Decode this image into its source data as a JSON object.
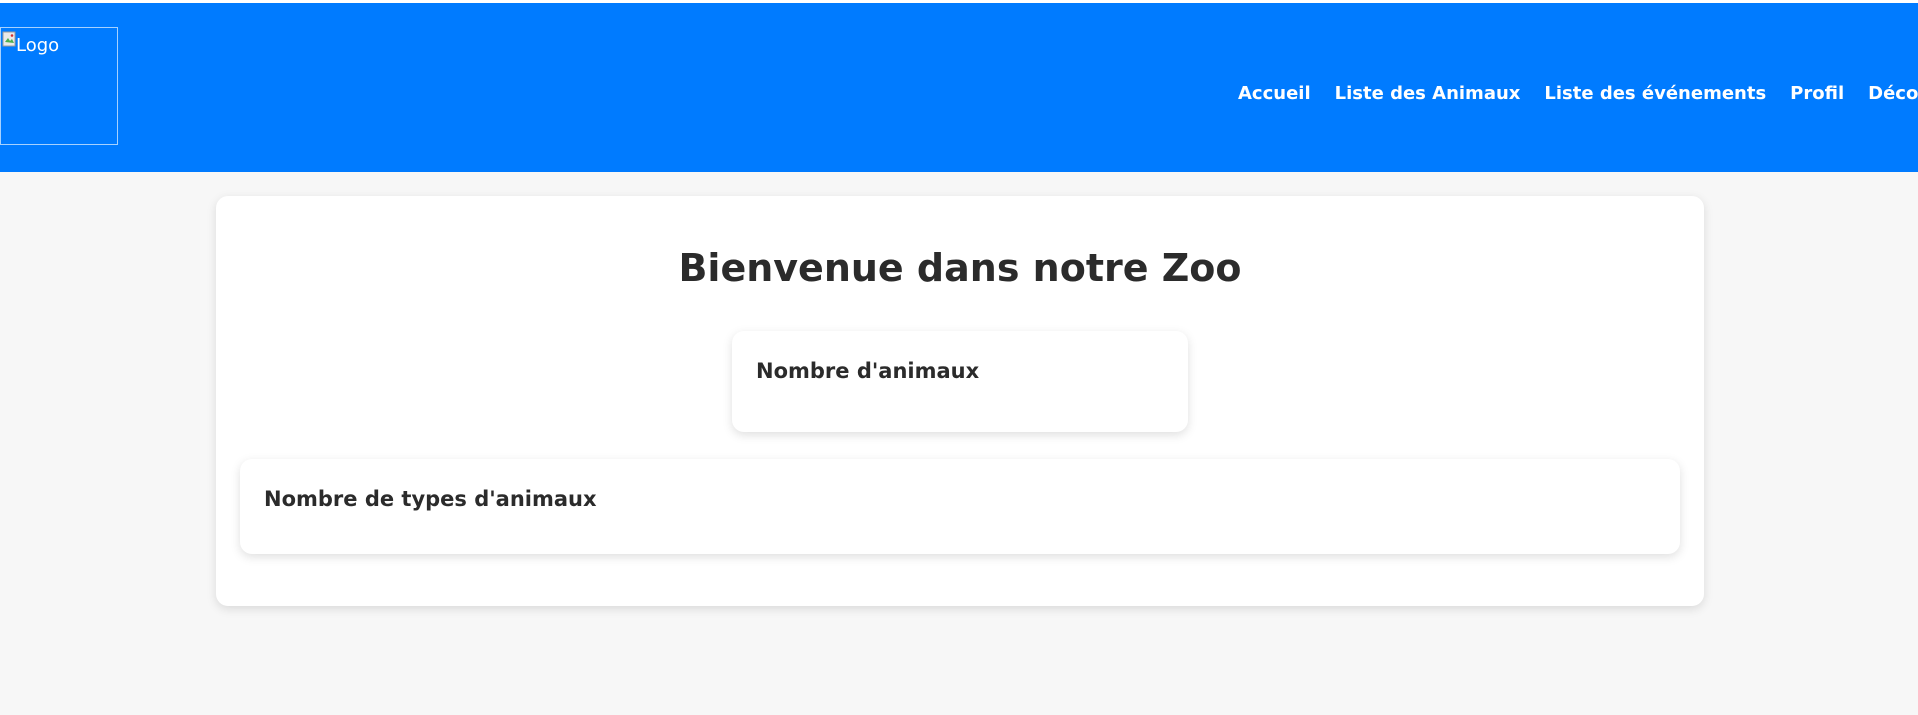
{
  "header": {
    "logo_alt": "Logo",
    "background_color": "#007bff",
    "nav": [
      {
        "label": "Accueil"
      },
      {
        "label": "Liste des Animaux"
      },
      {
        "label": "Liste des événements"
      },
      {
        "label": "Profil"
      },
      {
        "label": "Déconnexion"
      }
    ]
  },
  "main": {
    "title": "Bienvenue dans notre Zoo",
    "stats": [
      {
        "label": "Nombre d'animaux",
        "value": ""
      },
      {
        "label": "Nombre de types d'animaux",
        "value": ""
      }
    ]
  }
}
